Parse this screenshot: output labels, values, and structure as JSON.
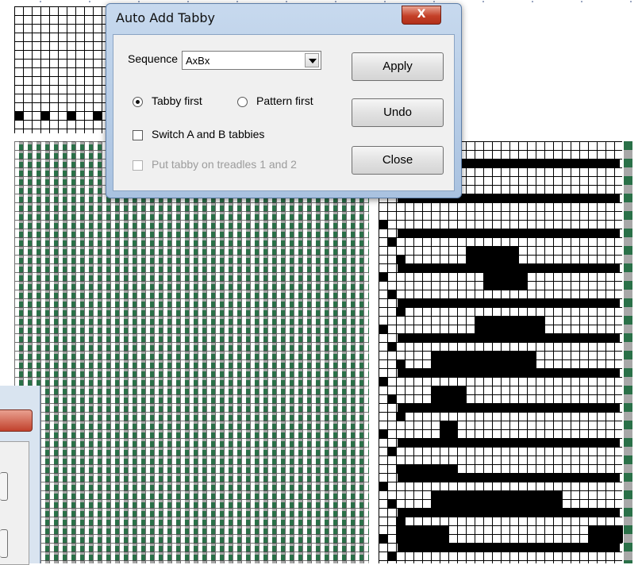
{
  "dialog": {
    "title": "Auto Add Tabby",
    "close_glyph": "X",
    "sequence_label": "Sequence",
    "sequence_value": "AxBx",
    "tabby_first_label": "Tabby first",
    "pattern_first_label": "Pattern first",
    "switch_label": "Switch A and B tabbies",
    "treadles_label": "Put tabby on treadles 1 and 2",
    "apply_label": "Apply",
    "undo_label": "Undo",
    "close_label": "Close",
    "tabby_first_checked": true,
    "pattern_first_checked": false,
    "switch_checked": false,
    "treadles_checked": false,
    "treadles_enabled": false
  },
  "colors": {
    "weave_green": "#2a7048",
    "weave_gray": "#a8a8a8",
    "dialog_frame": "#c7d9ee",
    "close_red": "#c44028"
  },
  "icons": {
    "dropdown": "chevron-down-icon",
    "close": "close-icon"
  }
}
